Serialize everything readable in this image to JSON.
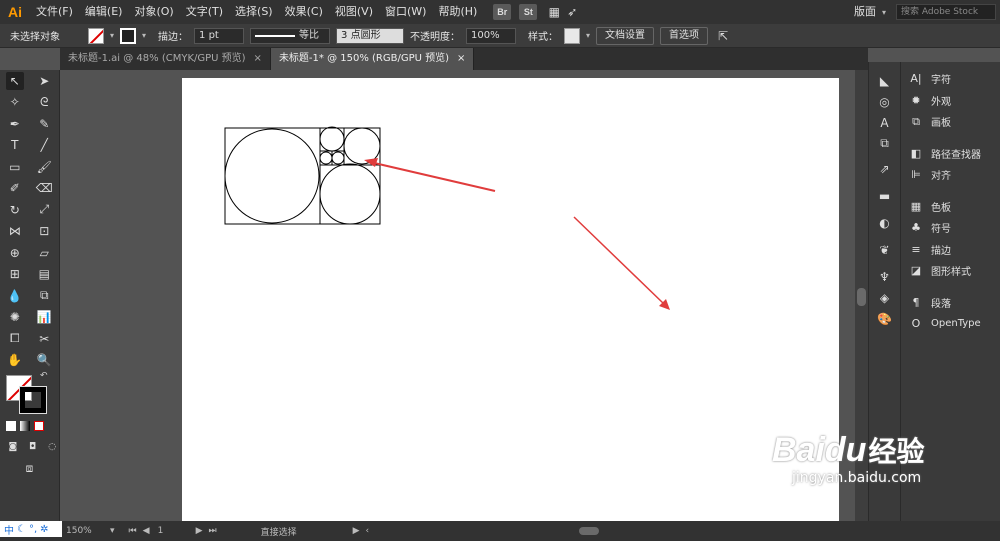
{
  "app": {
    "logo": "Ai"
  },
  "menu": [
    "文件(F)",
    "编辑(E)",
    "对象(O)",
    "文字(T)",
    "选择(S)",
    "效果(C)",
    "视图(V)",
    "窗口(W)",
    "帮助(H)"
  ],
  "menubar_icons": [
    "Br",
    "St"
  ],
  "workspace": "版面",
  "search_placeholder": "搜索 Adobe Stock",
  "control": {
    "selection_status": "未选择对象",
    "stroke_label": "描边：",
    "stroke_weight": "1 pt",
    "profile_label": "等比",
    "brush_label": "3 点圆形",
    "opacity_label": "不透明度：",
    "opacity_value": "100%",
    "style_label": "样式：",
    "doc_setup": "文档设置",
    "preferences": "首选项"
  },
  "tabs": [
    {
      "label": "未标题-1.ai @ 48% (CMYK/GPU 预览)",
      "close": "×"
    },
    {
      "label": "未标题-1* @ 150% (RGB/GPU 预览)",
      "close": "×"
    }
  ],
  "panels": {
    "group1": [
      "字符",
      "外观",
      "画板"
    ],
    "group2": [
      "路径查找器",
      "对齐"
    ],
    "group3": [
      "色板",
      "符号",
      "描边",
      "图形样式"
    ],
    "group4": [
      "段落",
      "OpenType"
    ]
  },
  "status": {
    "zoom": "150%",
    "page": "1",
    "tool": "直接选择"
  },
  "ime": {
    "lang": "中"
  },
  "watermark": {
    "brand": "Baidu",
    "sub": "经验",
    "url": "jingyan.baidu.com"
  },
  "colors": {
    "arrow": "#e03c3c",
    "stroke": "#000000"
  }
}
